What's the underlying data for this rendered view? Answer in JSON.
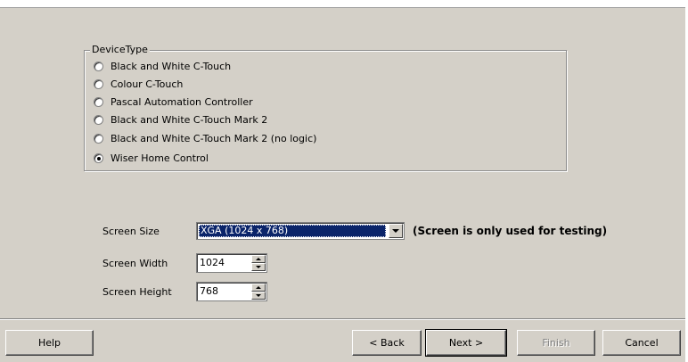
{
  "device_type": {
    "legend": "DeviceType",
    "options": [
      {
        "label": "Black and White C-Touch",
        "checked": false
      },
      {
        "label": "Colour C-Touch",
        "checked": false
      },
      {
        "label": "Pascal Automation Controller",
        "checked": false
      },
      {
        "label": "Black and White C-Touch Mark 2",
        "checked": false
      },
      {
        "label": "Black and White C-Touch Mark 2 (no logic)",
        "checked": false
      },
      {
        "label": "Wiser Home Control",
        "checked": true
      }
    ]
  },
  "screen": {
    "size_label": "Screen Size",
    "size_value": "XGA (1024 x 768)",
    "note": "(Screen is only used for testing)",
    "width_label": "Screen Width",
    "width_value": "1024",
    "height_label": "Screen Height",
    "height_value": "768"
  },
  "buttons": {
    "help": "Help",
    "back": "< Back",
    "next": "Next >",
    "finish": "Finish",
    "cancel": "Cancel"
  },
  "colors": {
    "face": "#d4d0c8",
    "selection": "#0a246a"
  }
}
